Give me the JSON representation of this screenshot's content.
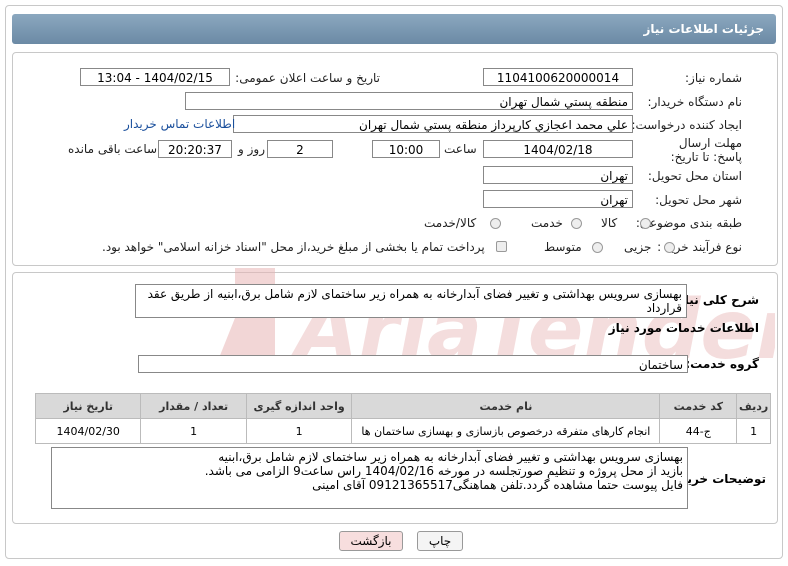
{
  "header": {
    "title": "جزئیات اطلاعات نیاز"
  },
  "form": {
    "need_number_label": "شماره نیاز:",
    "need_number": "1104100620000014",
    "announce_label": "تاریخ و ساعت اعلان عمومی:",
    "announce_value": "1404/02/15 - 13:04",
    "buyer_label": "نام دستگاه خریدار:",
    "buyer_value": "منطقه پستي شمال تهران",
    "creator_label": "ایجاد کننده درخواست:",
    "creator_value": "علي محمد اعجازي کارپرداز منطقه پستي شمال تهران",
    "contact_link": "اطلاعات تماس خریدار",
    "deadline_label": "مهلت ارسال پاسخ: تا تاریخ:",
    "deadline_date": "1404/02/18",
    "time_label": "ساعت",
    "deadline_time": "10:00",
    "days_value": "2",
    "days_label": "روز و",
    "remaining_time": "20:20:37",
    "remaining_label": "ساعت باقی مانده",
    "province_label": "استان محل تحویل:",
    "province_value": "تهران",
    "city_label": "شهر محل تحویل:",
    "city_value": "تهران",
    "category_label": "طبقه بندی موضوعی:",
    "category_options": [
      "کالا",
      "خدمت",
      "کالا/خدمت"
    ],
    "category_selected": "خدمت",
    "process_label": "نوع فرآیند خرید :",
    "process_options": [
      "جزیی",
      "متوسط"
    ],
    "process_note": "پرداخت تمام یا بخشی از مبلغ خرید،از محل \"اسناد خزانه اسلامی\" خواهد بود."
  },
  "description": {
    "label": "شرح کلی نیاز:",
    "text": "بهسازی سرویس بهداشتی  و تغییر فضای آبدارخانه به همراه زیر ساختمای  لازم شامل برق،ابنیه از طریق عقد قرارداد"
  },
  "services": {
    "section_title": "اطلاعات خدمات مورد نیاز",
    "group_label": "گروه خدمت:",
    "group_value": "ساختمان",
    "columns": [
      "ردیف",
      "کد خدمت",
      "نام خدمت",
      "واحد اندازه گیری",
      "تعداد / مقدار",
      "تاریخ نیاز"
    ],
    "rows": [
      [
        "1",
        "ج-44",
        "انجام کارهای متفرقه درخصوص بازسازی و بهسازی ساختمان ها",
        "1",
        "1",
        "1404/02/30"
      ]
    ]
  },
  "buyer_notes": {
    "label": "توضیحات خریدار:",
    "line1": "بهسازی سرویس بهداشتی  و تغییر فضای آبدارخانه به همراه زیر ساختمای  لازم شامل برق،ابنیه",
    "line2": "بازید از محل پروژه و تنظیم صورتجلسه در مورخه 1404/02/16 راس ساعت9 الزامی می باشد.",
    "line3": "فایل پیوست حتما مشاهده گردد.تلفن هماهنگی09121365517 آقای امینی"
  },
  "buttons": {
    "print": "چاپ",
    "back": "بازگشت"
  },
  "watermark": {
    "text": "AriaTender.neT"
  },
  "colors": {
    "header": "#7a98b2",
    "accent_link": "#1a4f9c",
    "back_button": "#f7dede",
    "watermark": "#e8b4b4"
  }
}
